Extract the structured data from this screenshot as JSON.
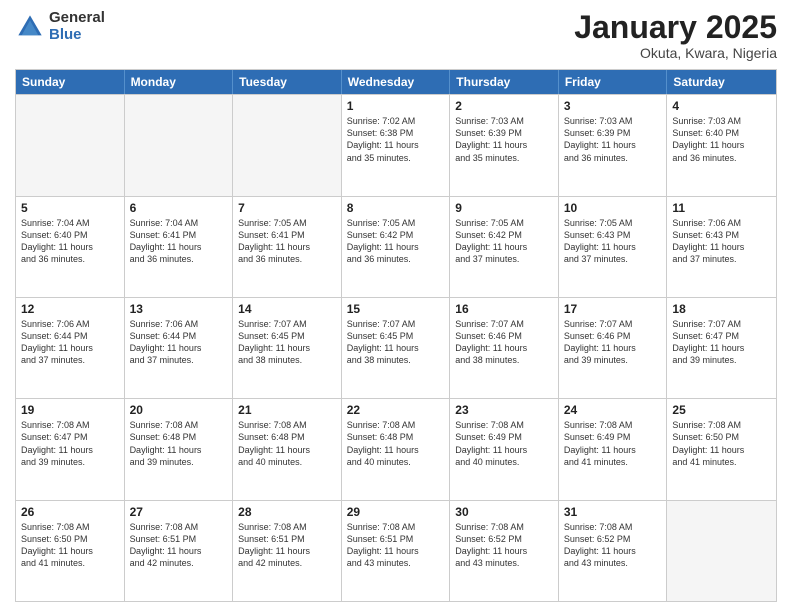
{
  "logo": {
    "general": "General",
    "blue": "Blue"
  },
  "title": "January 2025",
  "location": "Okuta, Kwara, Nigeria",
  "days_of_week": [
    "Sunday",
    "Monday",
    "Tuesday",
    "Wednesday",
    "Thursday",
    "Friday",
    "Saturday"
  ],
  "rows": [
    [
      {
        "day": "",
        "info": "",
        "empty": true
      },
      {
        "day": "",
        "info": "",
        "empty": true
      },
      {
        "day": "",
        "info": "",
        "empty": true
      },
      {
        "day": "1",
        "info": "Sunrise: 7:02 AM\nSunset: 6:38 PM\nDaylight: 11 hours\nand 35 minutes."
      },
      {
        "day": "2",
        "info": "Sunrise: 7:03 AM\nSunset: 6:39 PM\nDaylight: 11 hours\nand 35 minutes."
      },
      {
        "day": "3",
        "info": "Sunrise: 7:03 AM\nSunset: 6:39 PM\nDaylight: 11 hours\nand 36 minutes."
      },
      {
        "day": "4",
        "info": "Sunrise: 7:03 AM\nSunset: 6:40 PM\nDaylight: 11 hours\nand 36 minutes."
      }
    ],
    [
      {
        "day": "5",
        "info": "Sunrise: 7:04 AM\nSunset: 6:40 PM\nDaylight: 11 hours\nand 36 minutes."
      },
      {
        "day": "6",
        "info": "Sunrise: 7:04 AM\nSunset: 6:41 PM\nDaylight: 11 hours\nand 36 minutes."
      },
      {
        "day": "7",
        "info": "Sunrise: 7:05 AM\nSunset: 6:41 PM\nDaylight: 11 hours\nand 36 minutes."
      },
      {
        "day": "8",
        "info": "Sunrise: 7:05 AM\nSunset: 6:42 PM\nDaylight: 11 hours\nand 36 minutes."
      },
      {
        "day": "9",
        "info": "Sunrise: 7:05 AM\nSunset: 6:42 PM\nDaylight: 11 hours\nand 37 minutes."
      },
      {
        "day": "10",
        "info": "Sunrise: 7:05 AM\nSunset: 6:43 PM\nDaylight: 11 hours\nand 37 minutes."
      },
      {
        "day": "11",
        "info": "Sunrise: 7:06 AM\nSunset: 6:43 PM\nDaylight: 11 hours\nand 37 minutes."
      }
    ],
    [
      {
        "day": "12",
        "info": "Sunrise: 7:06 AM\nSunset: 6:44 PM\nDaylight: 11 hours\nand 37 minutes."
      },
      {
        "day": "13",
        "info": "Sunrise: 7:06 AM\nSunset: 6:44 PM\nDaylight: 11 hours\nand 37 minutes."
      },
      {
        "day": "14",
        "info": "Sunrise: 7:07 AM\nSunset: 6:45 PM\nDaylight: 11 hours\nand 38 minutes."
      },
      {
        "day": "15",
        "info": "Sunrise: 7:07 AM\nSunset: 6:45 PM\nDaylight: 11 hours\nand 38 minutes."
      },
      {
        "day": "16",
        "info": "Sunrise: 7:07 AM\nSunset: 6:46 PM\nDaylight: 11 hours\nand 38 minutes."
      },
      {
        "day": "17",
        "info": "Sunrise: 7:07 AM\nSunset: 6:46 PM\nDaylight: 11 hours\nand 39 minutes."
      },
      {
        "day": "18",
        "info": "Sunrise: 7:07 AM\nSunset: 6:47 PM\nDaylight: 11 hours\nand 39 minutes."
      }
    ],
    [
      {
        "day": "19",
        "info": "Sunrise: 7:08 AM\nSunset: 6:47 PM\nDaylight: 11 hours\nand 39 minutes."
      },
      {
        "day": "20",
        "info": "Sunrise: 7:08 AM\nSunset: 6:48 PM\nDaylight: 11 hours\nand 39 minutes."
      },
      {
        "day": "21",
        "info": "Sunrise: 7:08 AM\nSunset: 6:48 PM\nDaylight: 11 hours\nand 40 minutes."
      },
      {
        "day": "22",
        "info": "Sunrise: 7:08 AM\nSunset: 6:48 PM\nDaylight: 11 hours\nand 40 minutes."
      },
      {
        "day": "23",
        "info": "Sunrise: 7:08 AM\nSunset: 6:49 PM\nDaylight: 11 hours\nand 40 minutes."
      },
      {
        "day": "24",
        "info": "Sunrise: 7:08 AM\nSunset: 6:49 PM\nDaylight: 11 hours\nand 41 minutes."
      },
      {
        "day": "25",
        "info": "Sunrise: 7:08 AM\nSunset: 6:50 PM\nDaylight: 11 hours\nand 41 minutes."
      }
    ],
    [
      {
        "day": "26",
        "info": "Sunrise: 7:08 AM\nSunset: 6:50 PM\nDaylight: 11 hours\nand 41 minutes."
      },
      {
        "day": "27",
        "info": "Sunrise: 7:08 AM\nSunset: 6:51 PM\nDaylight: 11 hours\nand 42 minutes."
      },
      {
        "day": "28",
        "info": "Sunrise: 7:08 AM\nSunset: 6:51 PM\nDaylight: 11 hours\nand 42 minutes."
      },
      {
        "day": "29",
        "info": "Sunrise: 7:08 AM\nSunset: 6:51 PM\nDaylight: 11 hours\nand 43 minutes."
      },
      {
        "day": "30",
        "info": "Sunrise: 7:08 AM\nSunset: 6:52 PM\nDaylight: 11 hours\nand 43 minutes."
      },
      {
        "day": "31",
        "info": "Sunrise: 7:08 AM\nSunset: 6:52 PM\nDaylight: 11 hours\nand 43 minutes."
      },
      {
        "day": "",
        "info": "",
        "empty": true
      }
    ]
  ]
}
